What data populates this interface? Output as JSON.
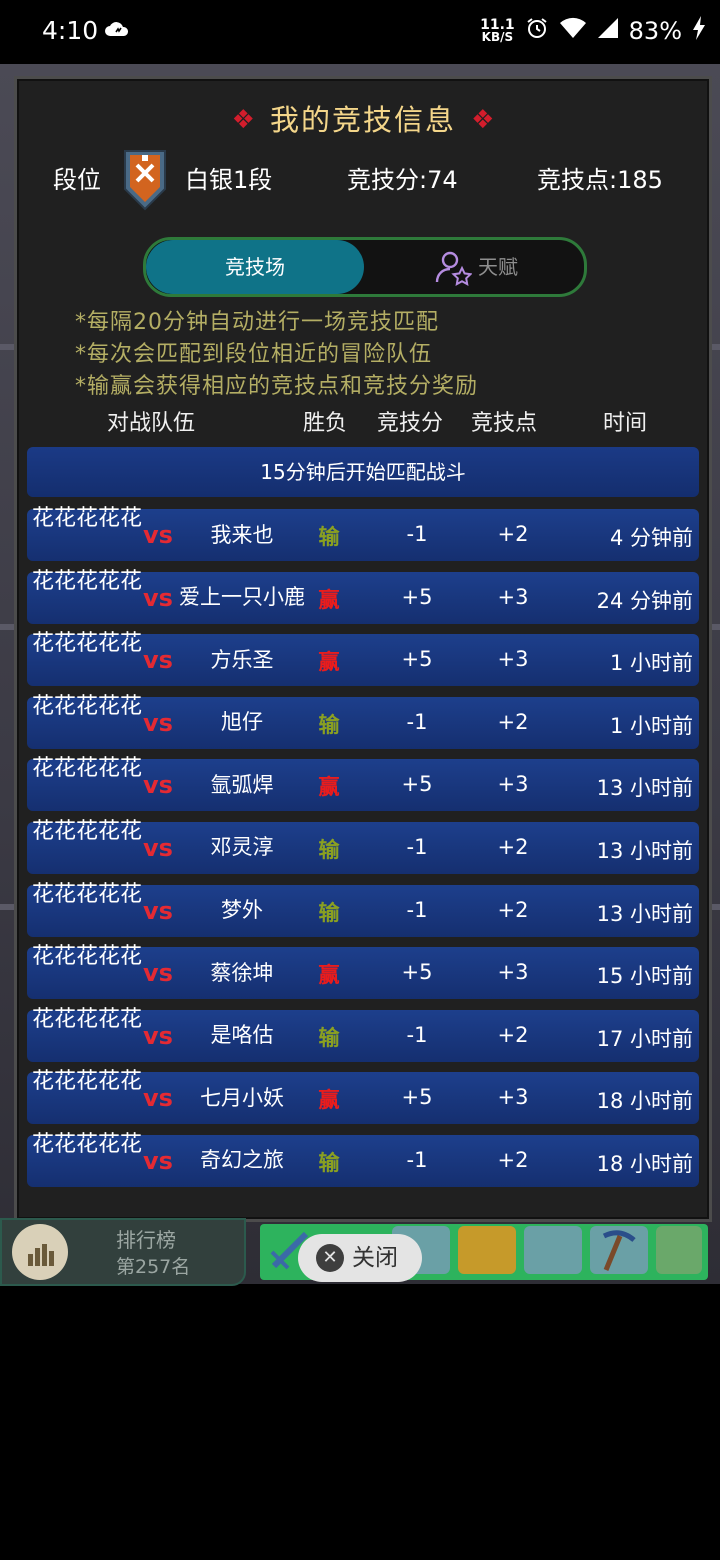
{
  "status_bar": {
    "time": "4:10",
    "net_speed": "11.1",
    "net_unit": "KB/S",
    "battery": "83%"
  },
  "modal": {
    "title": "我的竞技信息",
    "rank_label": "段位",
    "rank_name": "白银1段",
    "score_text": "竞技分:74",
    "points_text": "竞技点:185",
    "tabs": {
      "arena": "竞技场",
      "talent": "天赋"
    },
    "notes": [
      "*每隔20分钟自动进行一场竞技匹配",
      "*每次会匹配到段位相近的冒险队伍",
      "*输赢会获得相应的竞技点和竞技分奖励"
    ],
    "columns": {
      "team": "对战队伍",
      "result": "胜负",
      "score": "竞技分",
      "points": "竞技点",
      "time": "时间"
    },
    "banner": "15分钟后开始匹配战斗",
    "rows": [
      {
        "team": "花花花花花",
        "vs": "vs",
        "opponent": "我来也",
        "result": "输",
        "score": "-1",
        "points": "+2",
        "time": "4  分钟前"
      },
      {
        "team": "花花花花花",
        "vs": "vs",
        "opponent": "爱上一只小鹿",
        "result": "赢",
        "score": "+5",
        "points": "+3",
        "time": "24  分钟前"
      },
      {
        "team": "花花花花花",
        "vs": "vs",
        "opponent": "方乐圣",
        "result": "赢",
        "score": "+5",
        "points": "+3",
        "time": "1  小时前"
      },
      {
        "team": "花花花花花",
        "vs": "vs",
        "opponent": "旭仔",
        "result": "输",
        "score": "-1",
        "points": "+2",
        "time": "1  小时前"
      },
      {
        "team": "花花花花花",
        "vs": "vs",
        "opponent": "氩弧焊",
        "result": "赢",
        "score": "+5",
        "points": "+3",
        "time": "13  小时前"
      },
      {
        "team": "花花花花花",
        "vs": "vs",
        "opponent": "邓灵淳",
        "result": "输",
        "score": "-1",
        "points": "+2",
        "time": "13  小时前"
      },
      {
        "team": "花花花花花",
        "vs": "vs",
        "opponent": "梦外",
        "result": "输",
        "score": "-1",
        "points": "+2",
        "time": "13  小时前"
      },
      {
        "team": "花花花花花",
        "vs": "vs",
        "opponent": "蔡徐坤",
        "result": "赢",
        "score": "+5",
        "points": "+3",
        "time": "15  小时前"
      },
      {
        "team": "花花花花花",
        "vs": "vs",
        "opponent": "是咯估",
        "result": "输",
        "score": "-1",
        "points": "+2",
        "time": "17  小时前"
      },
      {
        "team": "花花花花花",
        "vs": "vs",
        "opponent": "七月小妖",
        "result": "赢",
        "score": "+5",
        "points": "+3",
        "time": "18  小时前"
      },
      {
        "team": "花花花花花",
        "vs": "vs",
        "opponent": "奇幻之旅",
        "result": "输",
        "score": "-1",
        "points": "+2",
        "time": "18  小时前"
      }
    ]
  },
  "bottom": {
    "leaderboard_label": "排行榜",
    "leaderboard_rank": "第257名",
    "close_label": "关闭"
  },
  "colors": {
    "title": "#f4d68a",
    "win": "#ea1c1c",
    "lose": "#8aa021",
    "tab_active": "#0f7388",
    "row_bg": "#1d3f8c"
  }
}
